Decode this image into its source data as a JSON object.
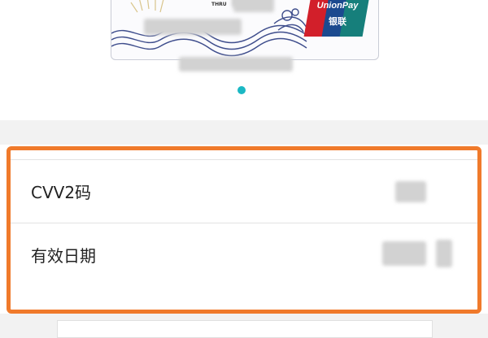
{
  "card": {
    "valid_thru_label": "VALID THRU",
    "brand_text": "UnionPay",
    "brand_text_cn": "银联"
  },
  "pager": {
    "active_index": 1,
    "count": 1
  },
  "fields": {
    "cvv_label": "CVV2码",
    "expiry_label": "有效日期"
  },
  "colors": {
    "highlight": "#f07a2b",
    "pager_dot": "#1bb8c4",
    "unionpay_red": "#d21f2a",
    "unionpay_blue": "#1b4a8f",
    "unionpay_teal": "#167f7b"
  }
}
